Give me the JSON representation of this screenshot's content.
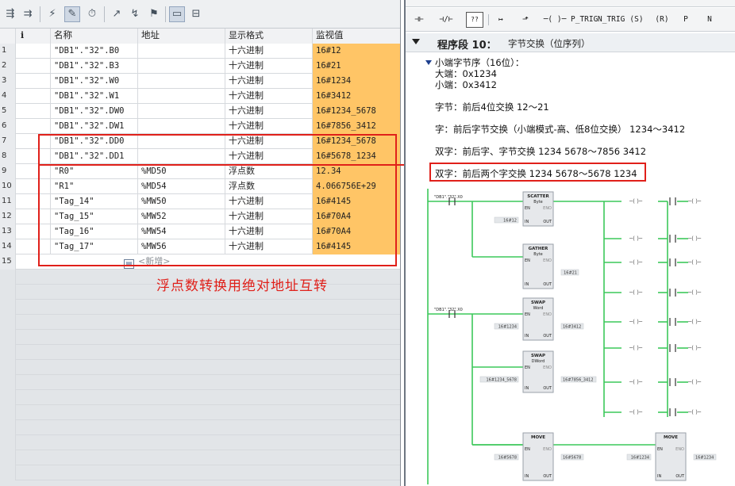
{
  "table": {
    "headers": {
      "icon": "i",
      "name": "名称",
      "address": "地址",
      "format": "显示格式",
      "value": "监视值"
    },
    "rows": [
      {
        "num": "1",
        "name": "\"DB1\".\"32\".B0",
        "addr": "",
        "fmt": "十六进制",
        "val": "16#12"
      },
      {
        "num": "2",
        "name": "\"DB1\".\"32\".B3",
        "addr": "",
        "fmt": "十六进制",
        "val": "16#21"
      },
      {
        "num": "3",
        "name": "\"DB1\".\"32\".W0",
        "addr": "",
        "fmt": "十六进制",
        "val": "16#1234"
      },
      {
        "num": "4",
        "name": "\"DB1\".\"32\".W1",
        "addr": "",
        "fmt": "十六进制",
        "val": "16#3412"
      },
      {
        "num": "5",
        "name": "\"DB1\".\"32\".DW0",
        "addr": "",
        "fmt": "十六进制",
        "val": "16#1234_5678"
      },
      {
        "num": "6",
        "name": "\"DB1\".\"32\".DW1",
        "addr": "",
        "fmt": "十六进制",
        "val": "16#7856_3412"
      },
      {
        "num": "7",
        "name": "\"DB1\".\"32\".DD0",
        "addr": "",
        "fmt": "十六进制",
        "val": "16#1234_5678"
      },
      {
        "num": "8",
        "name": "\"DB1\".\"32\".DD1",
        "addr": "",
        "fmt": "十六进制",
        "val": "16#5678_1234"
      },
      {
        "num": "9",
        "name": "\"R0\"",
        "addr": "%MD50",
        "fmt": "浮点数",
        "val": "12.34"
      },
      {
        "num": "10",
        "name": "\"R1\"",
        "addr": "%MD54",
        "fmt": "浮点数",
        "val": "4.066756E+29"
      },
      {
        "num": "11",
        "name": "\"Tag_14\"",
        "addr": "%MW50",
        "fmt": "十六进制",
        "val": "16#4145"
      },
      {
        "num": "12",
        "name": "\"Tag_15\"",
        "addr": "%MW52",
        "fmt": "十六进制",
        "val": "16#70A4"
      },
      {
        "num": "13",
        "name": "\"Tag_16\"",
        "addr": "%MW54",
        "fmt": "十六进制",
        "val": "16#70A4"
      },
      {
        "num": "14",
        "name": "\"Tag_17\"",
        "addr": "%MW56",
        "fmt": "十六进制",
        "val": "16#4145"
      }
    ],
    "new_row": {
      "num": "15",
      "label": "<新增>"
    }
  },
  "annotation": {
    "caption": "浮点数转换用绝对地址互转",
    "color": "#e0201a"
  },
  "ladder_toolbar": [
    "P_TRIG",
    "N_TRIG",
    "(S)",
    "(R)",
    "P",
    "N"
  ],
  "segment": {
    "label": "程序段 10：",
    "title": "字节交换（位序列）"
  },
  "comments": {
    "l1": "小端字节序（16位）：",
    "l2": "大端：0x1234",
    "l3": "小端：0x3412",
    "l4": "字节：前后4位交换  12～21",
    "l5": "字：前后字节交换（小端模式-高、低8位交换）   1234～3412",
    "l6": "双字：前后字、字节交换  1234 5678～7856 3412",
    "l7": "双字：前后两个字交换  1234 5678～5678 1234"
  },
  "ladder": {
    "instructions": [
      {
        "name": "SCATTER",
        "type": "Byte"
      },
      {
        "name": "GATHER",
        "type": "Byte"
      },
      {
        "name": "SWAP",
        "type": "Word"
      },
      {
        "name": "SWAP",
        "type": "DWord"
      },
      {
        "name": "MOVE",
        "type": ""
      },
      {
        "name": "MOVE",
        "type": ""
      }
    ],
    "in_values": [
      "16#12",
      "16#21",
      "16#1234",
      "16#1234_5678",
      "16#5678",
      "16#1234"
    ],
    "out_values": [
      "16#3412",
      "16#7856_3412",
      "16#5678",
      "16#1234"
    ],
    "pins": {
      "en": "EN",
      "eno": "ENO",
      "in": "IN",
      "out": "OUT",
      "out1": "OUT1"
    }
  },
  "colors": {
    "monitor_value": "#ffc566",
    "power_flow": "#3cc85a",
    "highlight": "#e0201a"
  }
}
